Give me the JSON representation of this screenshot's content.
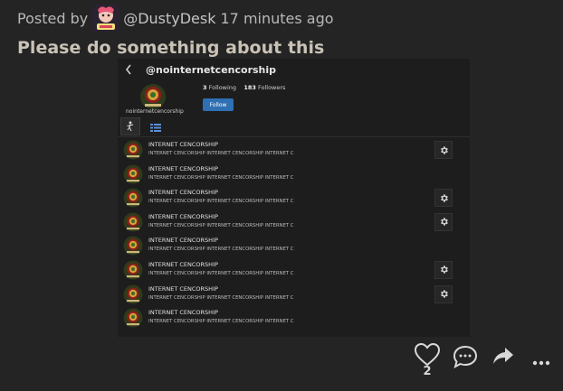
{
  "post": {
    "posted_by": "Posted by",
    "author": "@DustyDesk",
    "time_ago": "17 minutes ago",
    "title": "Please do something about this",
    "like_count": "2"
  },
  "screenshot": {
    "back_icon": "chevron-left-icon",
    "handle": "@nointernetcencorship",
    "profile_name": "nointernetcencorship",
    "following_count": "3",
    "following_label": "Following",
    "followers_count": "183",
    "followers_label": "Followers",
    "follow_button": "Follow",
    "tabs": [
      {
        "icon": "dancer-icon",
        "active": true
      },
      {
        "icon": "list-icon",
        "active": false
      }
    ],
    "rows": [
      {
        "title": "INTERNET CENCORSHIP",
        "text": "INTERNET CENCORSHIP INTERNET CENCORSHIP INTERNET C",
        "gear": true
      },
      {
        "title": "INTERNET CENCORSHIP",
        "text": "INTERNET CENCORSHIP INTERNET CENCORSHIP INTERNET C",
        "gear": false
      },
      {
        "title": "INTERNET CENCORSHIP",
        "text": "INTERNET CENCORSHIP INTERNET CENCORSHIP INTERNET C",
        "gear": true
      },
      {
        "title": "INTERNET CENCORSHIP",
        "text": "INTERNET CENCORSHIP INTERNET CENCORSHIP INTERNET C",
        "gear": true
      },
      {
        "title": "INTERNET CENCORSHIP",
        "text": "INTERNET CENCORSHIP INTERNET CENCORSHIP INTERNET C",
        "gear": false
      },
      {
        "title": "INTERNET CENCORSHIP",
        "text": "INTERNET CENCORSHIP INTERNET CENCORSHIP INTERNET C",
        "gear": true
      },
      {
        "title": "INTERNET CENCORSHIP",
        "text": "INTERNET CENCORSHIP INTERNET CENCORSHIP INTERNET C",
        "gear": true
      },
      {
        "title": "INTERNET CENCORSHIP",
        "text": "INTERNET CENCORSHIP INTERNET CENCORSHIP INTERNET C",
        "gear": false
      }
    ]
  },
  "actions": [
    {
      "name": "like",
      "icon": "heart-icon"
    },
    {
      "name": "comment",
      "icon": "comment-icon"
    },
    {
      "name": "share",
      "icon": "share-icon"
    },
    {
      "name": "more",
      "icon": "more-icon"
    }
  ],
  "colors": {
    "background": "#242424",
    "follow_button": "#2f6fb3"
  }
}
